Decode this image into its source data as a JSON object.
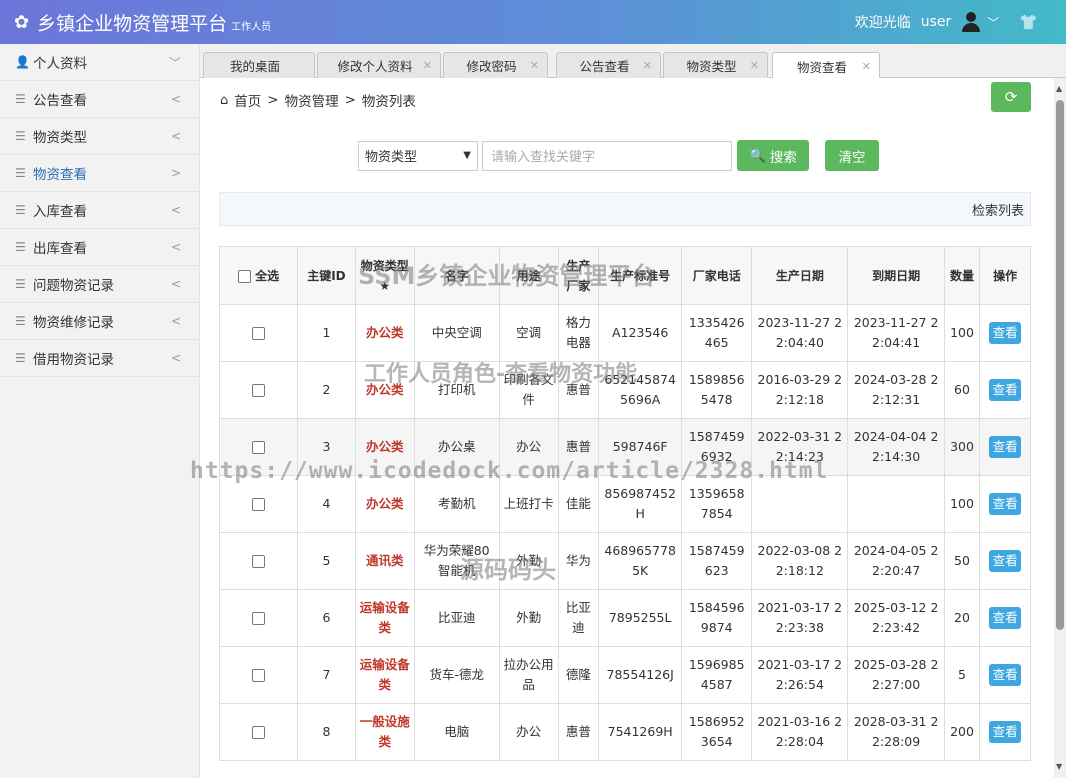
{
  "header": {
    "title": "乡镇企业物资管理平台",
    "subtitle": "工作人员",
    "welcome": "欢迎光临",
    "username": "user"
  },
  "sidebar": {
    "items": [
      {
        "label": "个人资料",
        "arrow": "﹀"
      },
      {
        "label": "公告查看",
        "arrow": "<"
      },
      {
        "label": "物资类型",
        "arrow": "<"
      },
      {
        "label": "物资查看",
        "arrow": ">"
      },
      {
        "label": "入库查看",
        "arrow": "<"
      },
      {
        "label": "出库查看",
        "arrow": "<"
      },
      {
        "label": "问题物资记录",
        "arrow": "<"
      },
      {
        "label": "物资维修记录",
        "arrow": "<"
      },
      {
        "label": "借用物资记录",
        "arrow": "<"
      }
    ]
  },
  "tabs": [
    {
      "label": "我的桌面"
    },
    {
      "label": "修改个人资料"
    },
    {
      "label": "修改密码"
    },
    {
      "label": "公告查看"
    },
    {
      "label": "物资类型"
    },
    {
      "label": "物资查看"
    }
  ],
  "breadcrumb": {
    "home": "首页",
    "level1": "物资管理",
    "level2": "物资列表",
    "sep": ">"
  },
  "search": {
    "select_value": "物资类型",
    "placeholder": "请输入查找关键字",
    "search_label": "搜索",
    "clear_label": "清空"
  },
  "list_title": "检索列表",
  "table": {
    "headers": {
      "select_all": "全选",
      "id": "主键ID",
      "type": "物资类型★",
      "name": "名字",
      "usage": "用途",
      "maker": "生产厂家",
      "std_no": "生产标准号",
      "phone": "厂家电话",
      "prod_date": "生产日期",
      "expire_date": "到期日期",
      "qty": "数量",
      "action": "操作"
    },
    "rows": [
      {
        "id": "1",
        "type": "办公类",
        "name": "中央空调",
        "usage": "空调",
        "maker": "格力电器",
        "std_no": "A123546",
        "phone": "1335426465",
        "prod_date": "2023-11-27 22:04:40",
        "expire_date": "2023-11-27 22:04:41",
        "qty": "100",
        "action": "查看"
      },
      {
        "id": "2",
        "type": "办公类",
        "name": "打印机",
        "usage": "印刷各文件",
        "maker": "惠普",
        "std_no": "6521458745696A",
        "phone": "15898565478",
        "prod_date": "2016-03-29 22:12:18",
        "expire_date": "2024-03-28 22:12:31",
        "qty": "60",
        "action": "查看"
      },
      {
        "id": "3",
        "type": "办公类",
        "name": "办公桌",
        "usage": "办公",
        "maker": "惠普",
        "std_no": "598746F",
        "phone": "15874596932",
        "prod_date": "2022-03-31 22:14:23",
        "expire_date": "2024-04-04 22:14:30",
        "qty": "300",
        "action": "查看"
      },
      {
        "id": "4",
        "type": "办公类",
        "name": "考勤机",
        "usage": "上班打卡",
        "maker": "佳能",
        "std_no": "856987452H",
        "phone": "13596587854",
        "prod_date": "",
        "expire_date": "",
        "qty": "100",
        "action": "查看"
      },
      {
        "id": "5",
        "type": "通讯类",
        "name": "华为荣耀80智能机",
        "usage": "外勤",
        "maker": "华为",
        "std_no": "4689657785K",
        "phone": "1587459623",
        "prod_date": "2022-03-08 22:18:12",
        "expire_date": "2024-04-05 22:20:47",
        "qty": "50",
        "action": "查看"
      },
      {
        "id": "6",
        "type": "运输设备类",
        "name": "比亚迪",
        "usage": "外勤",
        "maker": "比亚迪",
        "std_no": "7895255L",
        "phone": "15845969874",
        "prod_date": "2021-03-17 22:23:38",
        "expire_date": "2025-03-12 22:23:42",
        "qty": "20",
        "action": "查看"
      },
      {
        "id": "7",
        "type": "运输设备类",
        "name": "货车-德龙",
        "usage": "拉办公用品",
        "maker": "德隆",
        "std_no": "78554126J",
        "phone": "15969854587",
        "prod_date": "2021-03-17 22:26:54",
        "expire_date": "2025-03-28 22:27:00",
        "qty": "5",
        "action": "查看"
      },
      {
        "id": "8",
        "type": "一般设施类",
        "name": "电脑",
        "usage": "办公",
        "maker": "惠普",
        "std_no": "7541269H",
        "phone": "15869523654",
        "prod_date": "2021-03-16 22:28:04",
        "expire_date": "2028-03-31 22:28:09",
        "qty": "200",
        "action": "查看"
      }
    ]
  },
  "watermarks": {
    "line1": "SSM乡镇企业物资管理平台",
    "line2": "工作人员角色-查看物资功能",
    "line3": "https://www.icodedock.com/article/2328.html",
    "line4": "源码码头"
  },
  "colors": {
    "header_gradient_start": "#6c75d9",
    "header_gradient_end": "#43bac8",
    "accent_green": "#5cb85c",
    "view_button": "#3ea6e0",
    "type_text": "#c0392b",
    "active_sidebar": "#2a6fb3"
  }
}
